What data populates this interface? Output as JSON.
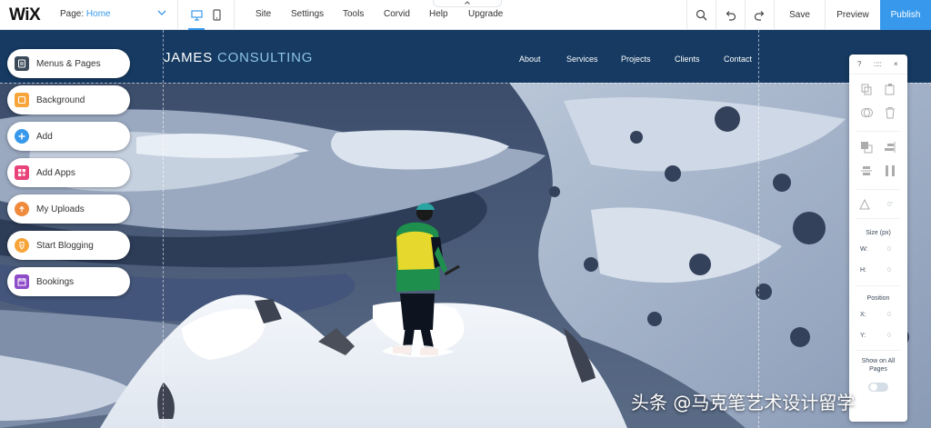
{
  "topbar": {
    "logo": "WiX",
    "page_label": "Page: ",
    "page_name": "Home",
    "menu": [
      "Site",
      "Settings",
      "Tools",
      "Corvid",
      "Help",
      "Upgrade"
    ],
    "save": "Save",
    "preview": "Preview",
    "publish": "Publish",
    "accent_color": "#3899ec"
  },
  "site": {
    "brand_part1": "JAMES ",
    "brand_part2": "CONSULTING",
    "nav": [
      "About",
      "Services",
      "Projects",
      "Clients",
      "Contact"
    ],
    "header_color": "#163a62"
  },
  "left_panel": {
    "items": [
      {
        "label": "Menus & Pages",
        "icon": "menus-pages-icon",
        "color": "#3b4a5a"
      },
      {
        "label": "Background",
        "icon": "background-icon",
        "color": "#f7a53a"
      },
      {
        "label": "Add",
        "icon": "add-icon",
        "color": "#3899ec"
      },
      {
        "label": "Add Apps",
        "icon": "add-apps-icon",
        "color": "#e8447a"
      },
      {
        "label": "My Uploads",
        "icon": "my-uploads-icon",
        "color": "#f08a3c"
      },
      {
        "label": "Start Blogging",
        "icon": "start-blogging-icon",
        "color": "#f7a53a"
      },
      {
        "label": "Bookings",
        "icon": "bookings-icon",
        "color": "#8e4cc9"
      }
    ]
  },
  "right_panel": {
    "help": "?",
    "grip": "::::",
    "close": "×",
    "angle_value": "0°",
    "size_label": "Size (px)",
    "w_label": "W:",
    "w_value": "0",
    "h_label": "H:",
    "h_value": "0",
    "position_label": "Position",
    "x_label": "X:",
    "x_value": "0",
    "y_label": "Y:",
    "y_value": "0",
    "show_on_all_pages": "Show on All Pages"
  },
  "watermark": "头条 @马克笔艺术设计留学"
}
